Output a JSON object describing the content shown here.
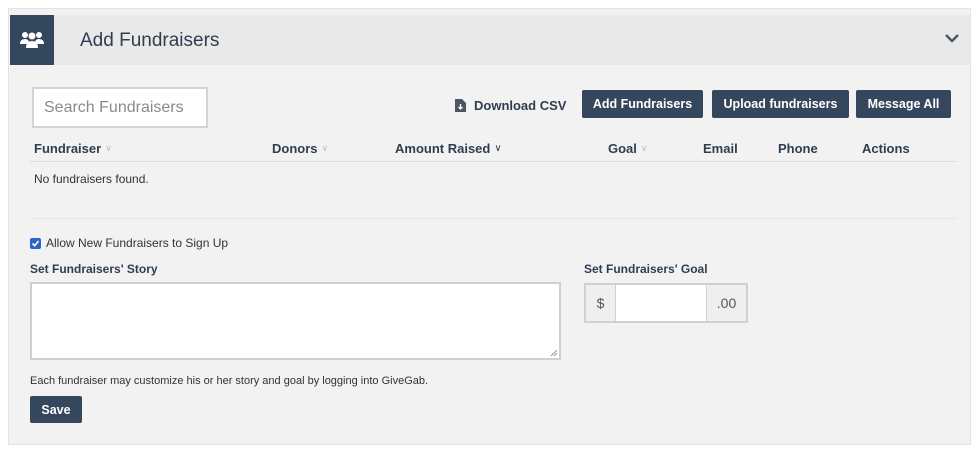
{
  "header": {
    "title": "Add Fundraisers",
    "icon": "users-icon",
    "icon_bg": "#34475c"
  },
  "toolbar": {
    "search_placeholder": "Search Fundraisers",
    "download_csv": "Download CSV",
    "add_fundraisers": "Add Fundraisers",
    "upload_fundraisers": "Upload fundraisers",
    "message_all": "Message All"
  },
  "table": {
    "columns": [
      "Fundraiser",
      "Donors",
      "Amount Raised",
      "Goal",
      "Email",
      "Phone",
      "Actions"
    ],
    "empty_message": "No fundraisers found."
  },
  "settings": {
    "allow_signup_label": "Allow New Fundraisers to Sign Up",
    "allow_signup_checked": true,
    "story_label": "Set Fundraisers' Story",
    "story_value": "",
    "goal_label": "Set Fundraisers' Goal",
    "goal_prefix": "$",
    "goal_suffix": ".00",
    "goal_value": "",
    "note": "Each fundraiser may customize his or her story and goal by logging into GiveGab.",
    "save_label": "Save"
  },
  "colors": {
    "accent": "#34475c",
    "checkbox": "#2d63c8",
    "panel": "#f2f2f2",
    "header_bg": "#e9e9e9"
  }
}
